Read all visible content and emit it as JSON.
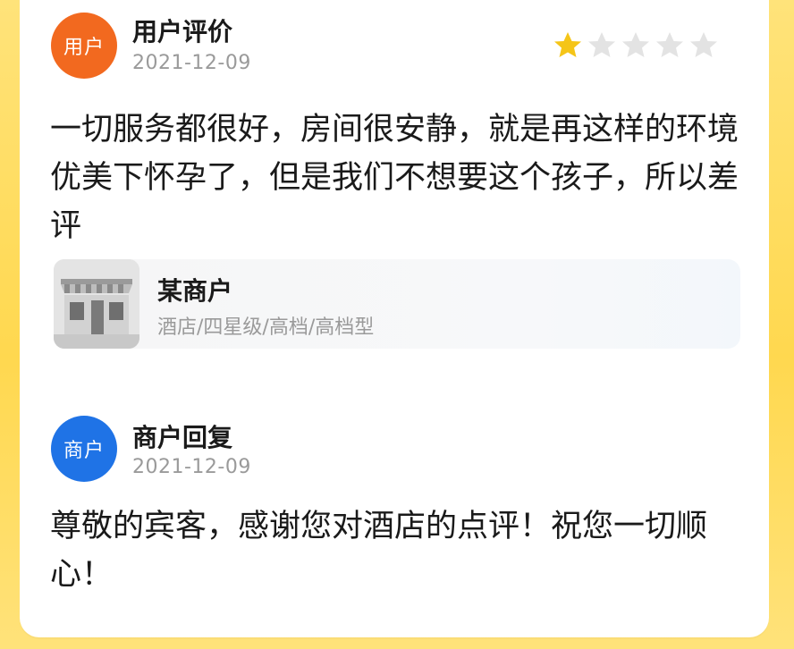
{
  "review": {
    "avatar_label": "用户",
    "author": "用户评价",
    "date": "2021-12-09",
    "rating": 1,
    "max_rating": 5,
    "text": "一切服务都很好，房间很安静，就是再这样的环境优美下怀孕了，但是我们不想要这个孩子，所以差评"
  },
  "shop": {
    "name": "某商户",
    "category": "酒店/四星级/高档/高档型",
    "thumbnail_icon": "storefront-icon"
  },
  "reply": {
    "avatar_label": "商户",
    "author": "商户回复",
    "date": "2021-12-09",
    "text": "尊敬的宾客，感谢您对酒店的点评！祝您一切顺心！"
  },
  "colors": {
    "user_avatar": "#f2691f",
    "merchant_avatar": "#1f73e6",
    "star_filled": "#f5c518",
    "star_empty": "#e3e3e3",
    "background": "#ffd84f"
  }
}
